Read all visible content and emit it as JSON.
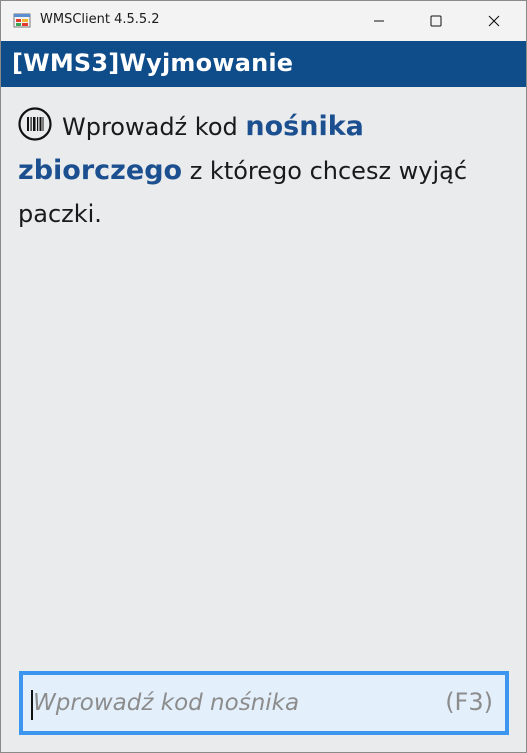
{
  "window": {
    "title": "WMSClient 4.5.5.2",
    "icons": {
      "app": "app-window-icon",
      "minimize": "minimize-icon",
      "maximize": "maximize-icon",
      "close": "close-icon"
    }
  },
  "header": {
    "title": "[WMS3]Wyjmowanie",
    "color": "#0f4c8a"
  },
  "prompt": {
    "icon": "barcode-icon",
    "part1": "Wprowadź kod ",
    "emphasis": "nośnika zbiorczego",
    "part2": " z którego chcesz wyjąć paczki.",
    "emphasis_color": "#1b4f8f"
  },
  "input": {
    "value": "",
    "placeholder": "Wprowadź kod nośnika",
    "shortcut": "(F3)",
    "border_color": "#3c96f0"
  }
}
